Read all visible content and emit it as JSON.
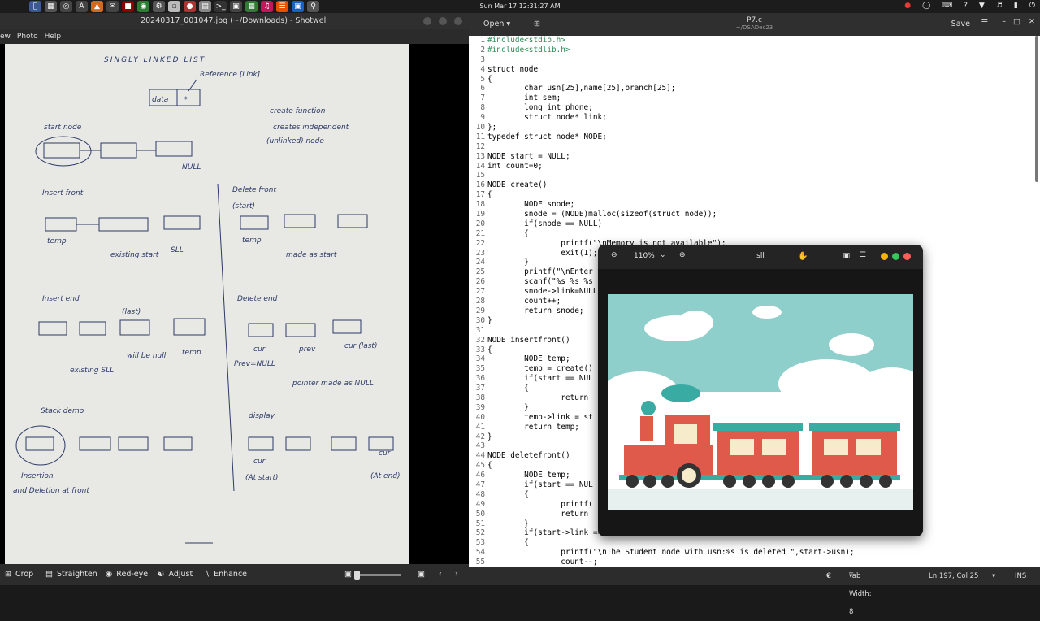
{
  "topbar": {
    "clock": "Sun Mar 17  12:31:27 AM",
    "launchers": [
      "apple-logo-icon",
      "terminal-icon",
      "chrome-like-icon",
      "vpn-icon",
      "mail-icon",
      "photos-icon",
      "firefox-icon",
      "chrome-icon",
      "terminal-icon",
      "files-icon",
      "terminal-icon",
      "app-icon",
      "app-icon",
      "app-icon",
      "app-icon",
      "app-icon",
      "app-icon",
      "app-icon",
      "search-icon"
    ]
  },
  "shotwell": {
    "title": "20240317_001047.jpg (~/Downloads) - Shotwell",
    "menu": [
      "ew",
      "Photo",
      "Help"
    ],
    "toolbar": {
      "crop": "Crop",
      "straighten": "Straighten",
      "redeye": "Red-eye",
      "adjust": "Adjust",
      "enhance": "Enhance"
    },
    "notes": {
      "heading": "SINGLY LINKED LIST",
      "reference": "Reference [Link]",
      "data": "data",
      "star": "*",
      "create_function": "create function",
      "creates": "creates independent",
      "unlinked": "(unlinked) node",
      "start_node": "start node",
      "null": "NULL",
      "insert_front": "Insert front",
      "temp": "temp",
      "existing_start": "existing start",
      "sll": "SLL",
      "delete_front": "Delete front",
      "start_paren": "(start)",
      "made_start": "made as start",
      "insert_end": "Insert end",
      "last": "(last)",
      "will_be_null": "will be null",
      "existing_sll": "existing SLL",
      "delete_end": "Delete end",
      "cur": "cur",
      "prev": "prev",
      "cur_last": "cur (last)",
      "prev_null": "Prev=NULL",
      "pointer_null": "pointer made as NULL",
      "stack_demo": "Stack demo",
      "insertion": "Insertion",
      "and_deletion": "and Deletion at front",
      "display": "display",
      "at_start": "(At start)",
      "at_end": "(At end)"
    }
  },
  "editor": {
    "open_label": "Open",
    "title": "P7.c",
    "subtitle": "~/DSADec23",
    "save_label": "Save",
    "status": {
      "lang": "C",
      "tab": "Tab Width: 8",
      "pos": "Ln 197, Col 25",
      "mode": "INS"
    },
    "lines": [
      "#include<stdio.h>",
      "#include<stdlib.h>",
      "",
      "struct node",
      "{",
      "        char usn[25],name[25],branch[25];",
      "        int sem;",
      "        long int phone;",
      "        struct node* link;",
      "};",
      "typedef struct node* NODE;",
      "",
      "NODE start = NULL;",
      "int count=0;",
      "",
      "NODE create()",
      "{",
      "        NODE snode;",
      "        snode = (NODE)malloc(sizeof(struct node));",
      "        if(snode == NULL)",
      "        {",
      "                printf(\"\\nMemory is not available\");",
      "                exit(1);",
      "        }",
      "        printf(\"\\nEnter",
      "        scanf(\"%s %s %s                                                 ->phone);",
      "        snode->link=NULL",
      "        count++;",
      "        return snode;",
      "}",
      "",
      "NODE insertfront()",
      "{",
      "        NODE temp;",
      "        temp = create()",
      "        if(start == NUL",
      "        {",
      "                return",
      "        }",
      "        temp->link = st",
      "        return temp;",
      "}",
      "",
      "NODE deletefront()",
      "{",
      "        NODE temp;",
      "        if(start == NUL",
      "        {",
      "                printf(",
      "                return",
      "        }",
      "        if(start->link == NULL) // Only start node is present in the SLL",
      "        {",
      "                printf(\"\\nThe Student node with usn:%s is deleted \",start->usn);",
      "                count--;"
    ]
  },
  "viewer": {
    "zoom": "110%",
    "title": "sll"
  },
  "colors": {
    "sky": "#8fcfcb",
    "train_red": "#e05a4c",
    "smoke": "#3aaba3",
    "ground": "#e8f0ef"
  }
}
